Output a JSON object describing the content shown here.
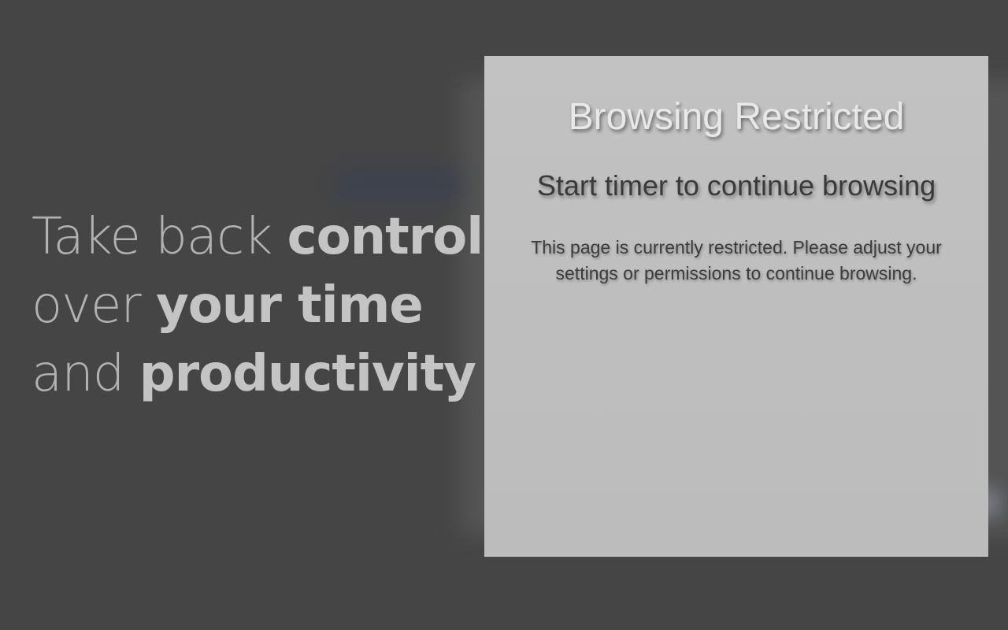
{
  "promo": {
    "line1_light": "Take back ",
    "line1_bold": "control",
    "line2_light": "over ",
    "line2_bold": "your time",
    "line3_light": "and ",
    "line3_bold": "productivity"
  },
  "panel": {
    "title": "Browsing Restricted",
    "subtitle": "Start timer to continue browsing",
    "message": "This page is currently restricted. Please adjust your settings or permissions to continue browsing."
  },
  "colors": {
    "background": "#454545",
    "panel": "#c0c0c0",
    "tagline": "#bcbcbc"
  }
}
